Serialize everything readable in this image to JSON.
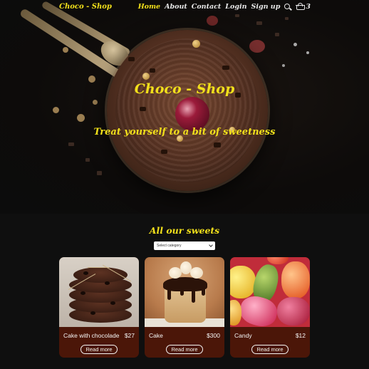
{
  "brand": "Choco - Shop",
  "nav": {
    "links": [
      "Home",
      "About",
      "Contact",
      "Login",
      "Sign up"
    ],
    "active": "Home",
    "search_icon": "search-icon",
    "cart_icon": "basket-icon",
    "cart_count": "3"
  },
  "hero": {
    "title": "Choco - Shop",
    "subtitle": "Treat yourself to a bit of sweetness"
  },
  "sweets": {
    "title": "All our sweets",
    "select_value": "Select category",
    "products": [
      {
        "name": "Cake with chocolade",
        "price": "$27",
        "button": "Read more"
      },
      {
        "name": "Cake",
        "price": "$300",
        "button": "Read more"
      },
      {
        "name": "Candy",
        "price": "$12",
        "button": "Read more"
      }
    ]
  },
  "colors": {
    "accent": "#f2e01b",
    "background": "#0f0f0f",
    "card": "#4b1608"
  }
}
